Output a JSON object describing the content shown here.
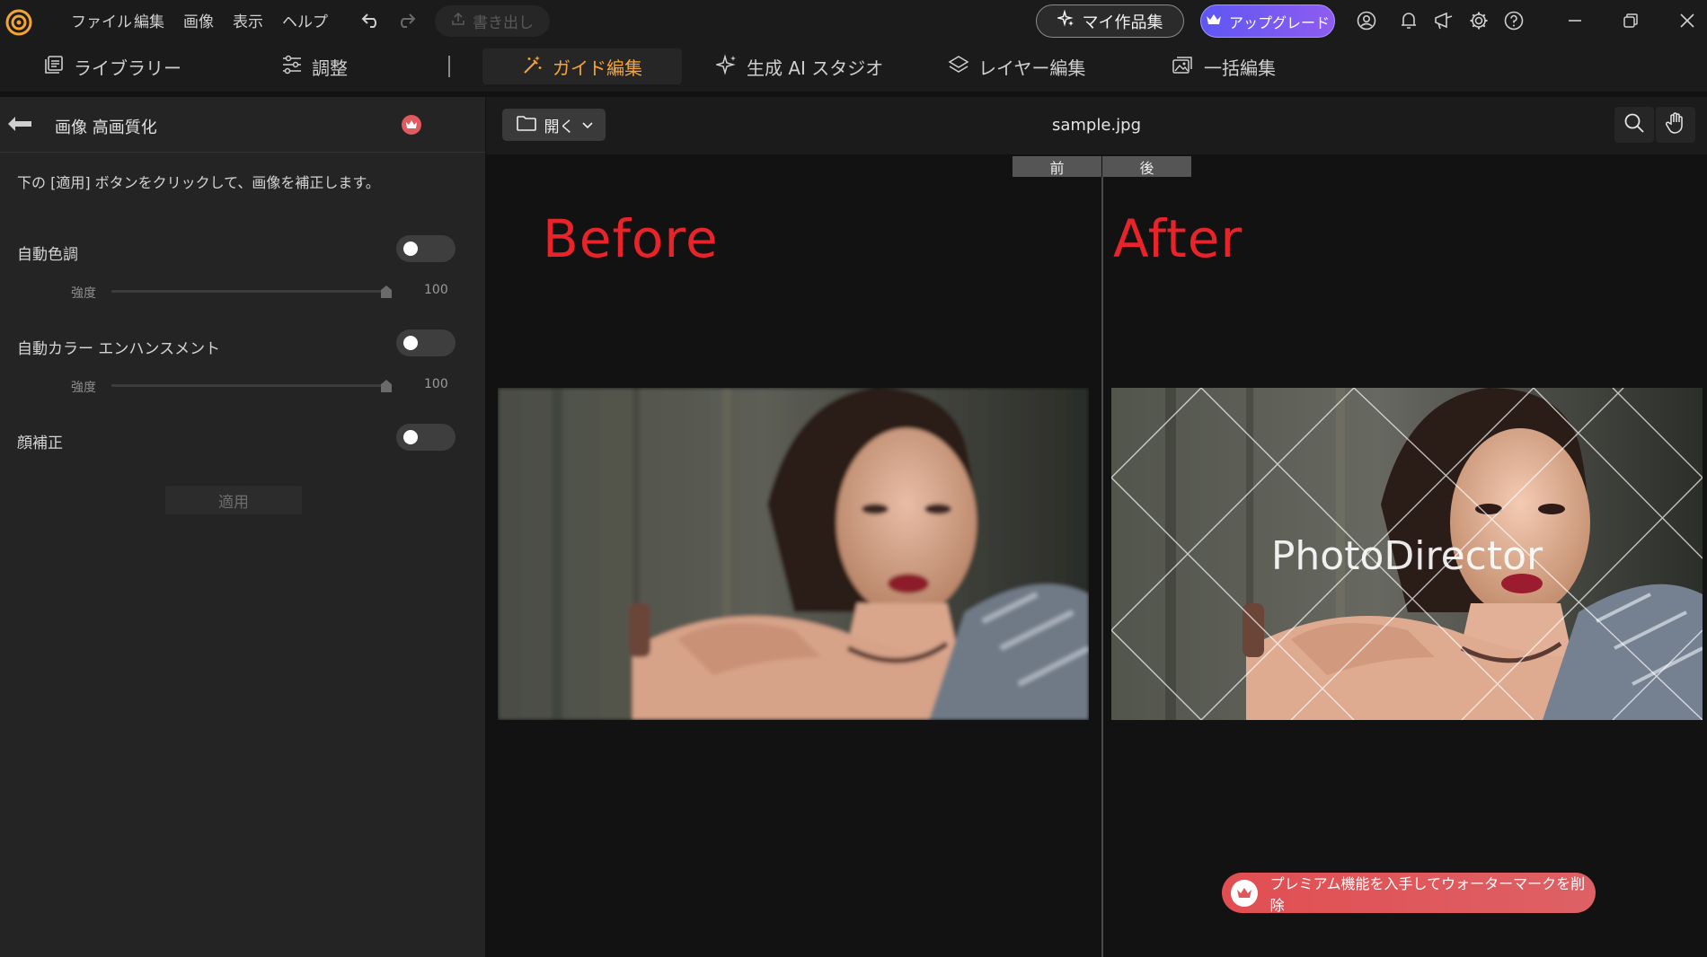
{
  "titlebar": {
    "menu": [
      "ファイル",
      "編集",
      "画像",
      "表示",
      "ヘルプ"
    ],
    "export_label": "書き出し",
    "my_works_label": "マイ作品集",
    "upgrade_label": "アップグレード"
  },
  "tabs": [
    {
      "label": "ライブラリー",
      "icon": "library-icon"
    },
    {
      "label": "調整",
      "icon": "sliders-icon"
    },
    {
      "label": "ガイド編集",
      "icon": "magic-wand-icon",
      "active": true
    },
    {
      "label": "生成 AI スタジオ",
      "icon": "sparkle-icon"
    },
    {
      "label": "レイヤー編集",
      "icon": "layers-icon"
    },
    {
      "label": "一括編集",
      "icon": "batch-images-icon"
    }
  ],
  "panel": {
    "title": "画像 高画質化",
    "description": "下の [適用] ボタンをクリックして、画像を補正します。",
    "options": [
      {
        "label": "自動色調",
        "enabled": false,
        "strength_label": "強度",
        "strength": 100
      },
      {
        "label": "自動カラー エンハンスメント",
        "enabled": false,
        "strength_label": "強度",
        "strength": 100
      },
      {
        "label": "顔補正",
        "enabled": false
      }
    ],
    "apply_label": "適用"
  },
  "viewer": {
    "open_label": "開く",
    "filename": "sample.jpg",
    "before_tab": "前",
    "after_tab": "後",
    "before_heading": "Before",
    "after_heading": "After",
    "watermark_text": "PhotoDirector",
    "premium_banner": "プレミアム機能を入手してウォーターマークを削除"
  },
  "colors": {
    "accent": "#f5a33a",
    "upgrade": "#6b5cf2",
    "heading_red": "#e8232a",
    "premium_banner": "#e0575b"
  }
}
